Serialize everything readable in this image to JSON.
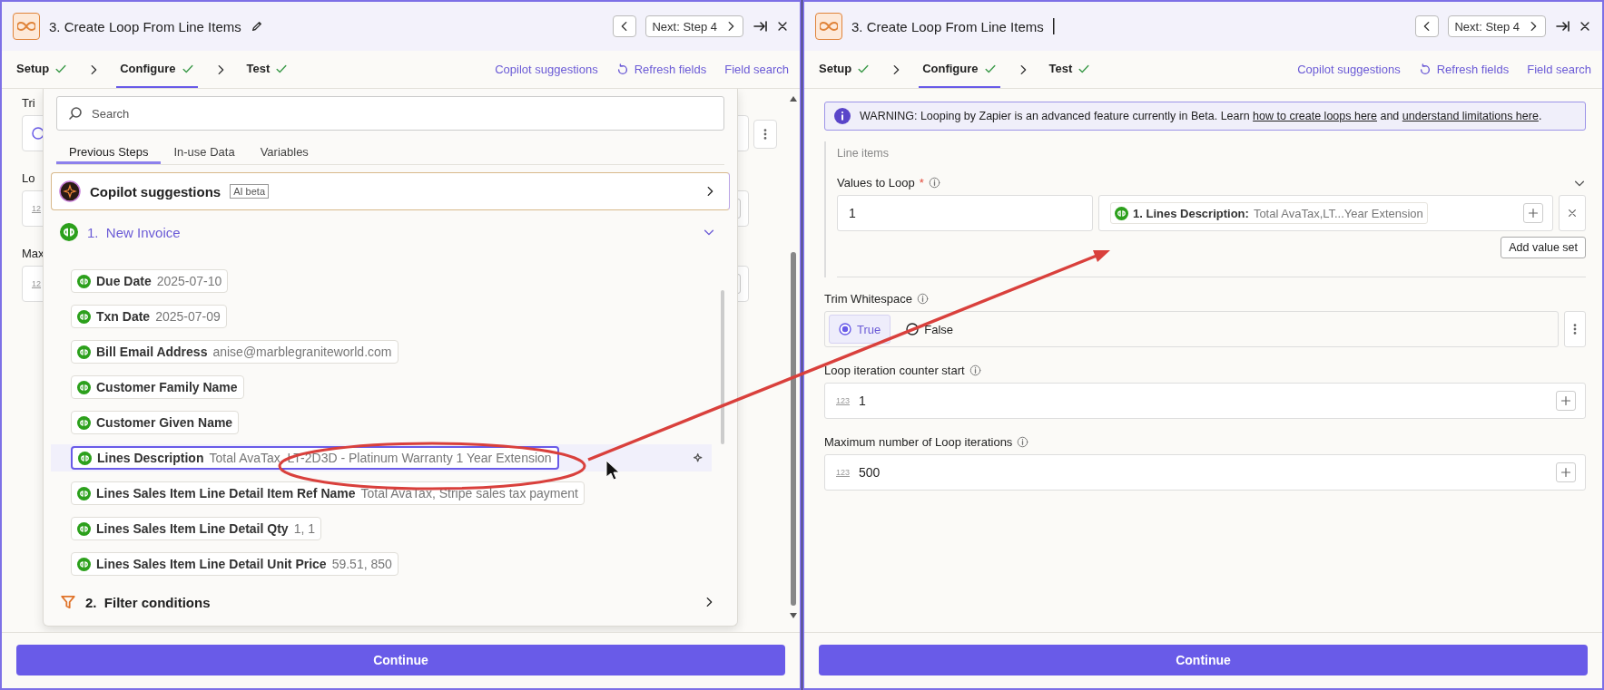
{
  "panels": [
    {
      "header": {
        "step": "3.",
        "title": "Create Loop From Line Items",
        "editing": false,
        "next": "Next: Step 4"
      },
      "tabs": [
        {
          "label": "Setup",
          "done": true,
          "selected": false
        },
        {
          "label": "Configure",
          "done": true,
          "selected": true
        },
        {
          "label": "Test",
          "done": true,
          "selected": false
        }
      ],
      "links": [
        {
          "label": "Copilot suggestions"
        },
        {
          "label": "Refresh fields"
        },
        {
          "label": "Field search"
        }
      ],
      "content": {
        "kind": "picker",
        "background_fields": [
          {
            "label": "Tri",
            "kind": "radio"
          },
          {
            "label": "Lo",
            "kind": "number",
            "hint": "12"
          },
          {
            "label": "Max",
            "kind": "number",
            "hint": "12"
          }
        ],
        "picker": {
          "search": {
            "placeholder": "Search"
          },
          "tabs": [
            {
              "label": "Previous Steps",
              "selected": true
            },
            {
              "label": "In-use Data",
              "selected": false
            },
            {
              "label": "Variables",
              "selected": false
            }
          ],
          "copilot": {
            "title": "Copilot suggestions",
            "badge": "AI beta"
          },
          "steps": [
            {
              "number": "1.",
              "title": "New Invoice",
              "kind": "app",
              "expanded": true,
              "fields": [
                {
                  "label": "Due Date",
                  "value": "2025-07-10",
                  "highlighted": false
                },
                {
                  "label": "Txn Date",
                  "value": "2025-07-09",
                  "highlighted": false
                },
                {
                  "label": "Bill Email Address",
                  "value": "anise@marblegraniteworld.com",
                  "highlighted": false
                },
                {
                  "label": "Customer Family Name",
                  "highlighted": false
                },
                {
                  "label": "Customer Given Name",
                  "highlighted": false
                },
                {
                  "label": "Lines Description",
                  "value": "Total AvaTax, LT-2D3D - Platinum Warranty 1 Year Extension",
                  "highlighted": true
                },
                {
                  "label": "Lines Sales Item Line Detail Item Ref Name",
                  "value": "Total AvaTax, Stripe sales tax payment",
                  "highlighted": false
                },
                {
                  "label": "Lines Sales Item Line Detail Qty",
                  "value": "1, 1",
                  "highlighted": false
                },
                {
                  "label": "Lines Sales Item Line Detail Unit Price",
                  "value": "59.51, 850",
                  "highlighted": false
                }
              ]
            },
            {
              "number": "2.",
              "title": "Filter conditions",
              "kind": "filter",
              "expanded": false
            }
          ]
        }
      },
      "continue": "Continue"
    },
    {
      "header": {
        "step": "3.",
        "title": "Create Loop From Line Items",
        "editing": true,
        "next": "Next: Step 4"
      },
      "tabs": [
        {
          "label": "Setup",
          "done": true,
          "selected": false
        },
        {
          "label": "Configure",
          "done": true,
          "selected": true
        },
        {
          "label": "Test",
          "done": true,
          "selected": false
        }
      ],
      "links": [
        {
          "label": "Copilot suggestions"
        },
        {
          "label": "Refresh fields"
        },
        {
          "label": "Field search"
        }
      ],
      "content": {
        "kind": "form",
        "warning": [
          {
            "text": "WARNING: Looping by Zapier is an advanced feature currently in Beta. Learn "
          },
          {
            "link": "how to create loops here"
          },
          {
            "text": " and "
          },
          {
            "link": "understand limitations here"
          },
          {
            "text": "."
          }
        ],
        "line_items": {
          "section": "Line items",
          "label": "Values to Loop",
          "required": "*",
          "key": "1",
          "pill_step": "1. Lines Description:",
          "pill_value": "Total AvaTax,LT...Year Extension",
          "add_button": "Add value set"
        },
        "trim": {
          "label": "Trim Whitespace",
          "options": [
            {
              "label": "True",
              "selected": true
            },
            {
              "label": "False",
              "selected": false
            }
          ]
        },
        "number_fields": [
          {
            "label": "Loop iteration counter start",
            "hint": "123",
            "value": "1"
          },
          {
            "label": "Maximum number of Loop iterations",
            "hint": "123",
            "value": "500"
          }
        ]
      },
      "continue": "Continue"
    }
  ]
}
